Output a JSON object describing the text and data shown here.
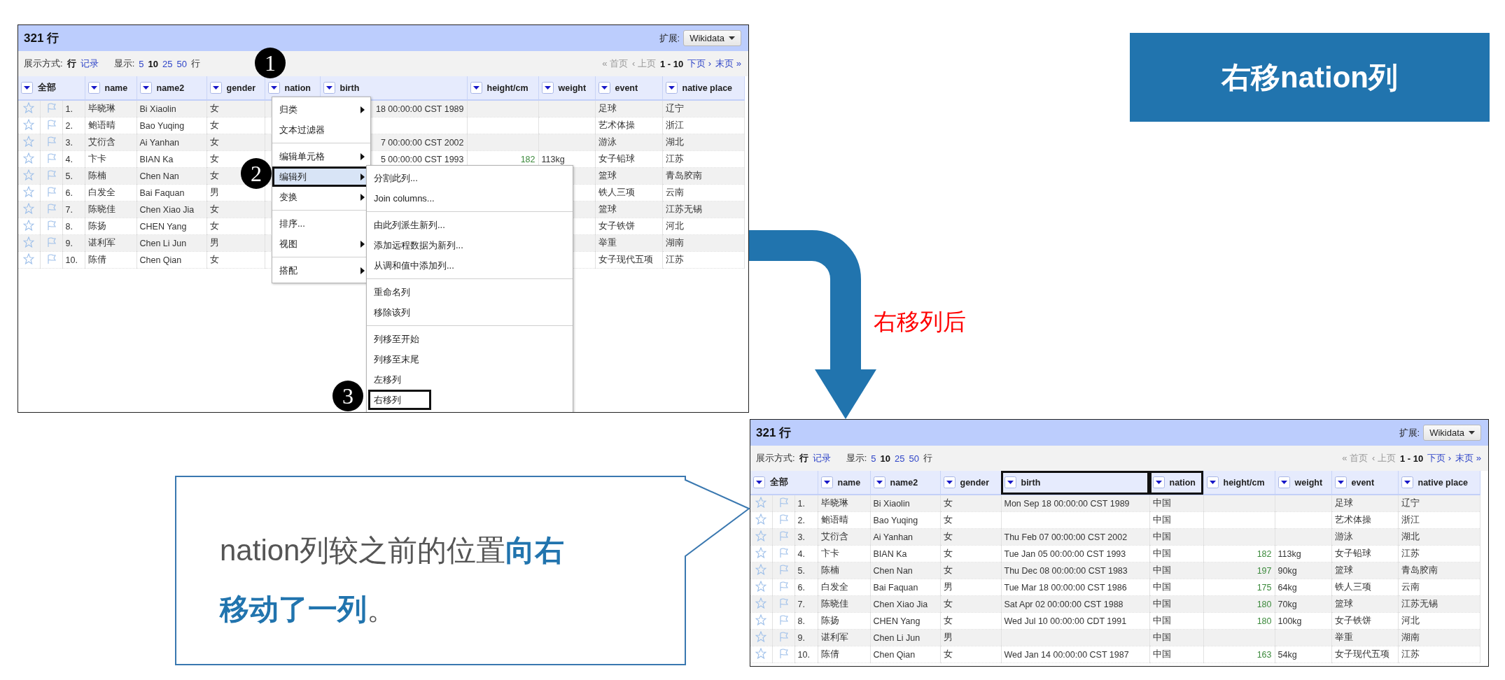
{
  "title": "右移nation列",
  "screenshots": [
    {
      "header": {
        "row_count": "321 行",
        "extension_label": "扩展:",
        "extension_button": "Wikidata"
      },
      "toolbar": {
        "view_label": "展示方式:",
        "view_modes": [
          {
            "label": "行",
            "selected": true
          },
          {
            "label": "记录",
            "selected": false
          }
        ],
        "show_label": "显示:",
        "page_sizes": [
          {
            "label": "5",
            "selected": false
          },
          {
            "label": "10",
            "selected": true
          },
          {
            "label": "25",
            "selected": false
          },
          {
            "label": "50",
            "selected": false
          }
        ],
        "show_unit": "行",
        "pager": [
          {
            "label": "« 首页",
            "kind": "disabled"
          },
          {
            "label": "‹ 上页",
            "kind": "disabled"
          },
          {
            "label": "1 - 10",
            "kind": "current"
          },
          {
            "label": "下页 ›",
            "kind": "link"
          },
          {
            "label": "末页 »",
            "kind": "link"
          }
        ]
      },
      "columns": [
        {
          "label": "全部",
          "kind": "all",
          "colspan": 3,
          "boxed": false
        },
        {
          "label": "name",
          "kind": "text",
          "boxed": false
        },
        {
          "label": "name2",
          "kind": "text",
          "boxed": false
        },
        {
          "label": "gender",
          "kind": "text",
          "boxed": false
        },
        {
          "label": "nation",
          "kind": "text",
          "boxed": false
        },
        {
          "label": "birth",
          "kind": "clipped",
          "boxed": false
        },
        {
          "label": "height/cm",
          "kind": "number",
          "boxed": false
        },
        {
          "label": "weight",
          "kind": "text",
          "boxed": false
        },
        {
          "label": "event",
          "kind": "text",
          "boxed": false
        },
        {
          "label": "native place",
          "kind": "text",
          "boxed": false
        }
      ],
      "rows": [
        {
          "cells": [
            "",
            "",
            "1.",
            "毕晓琳",
            "Bi Xiaolin",
            "女",
            "",
            "18 00:00:00 CST 1989",
            "",
            "",
            "足球",
            "辽宁"
          ]
        },
        {
          "cells": [
            "",
            "",
            "2.",
            "鲍语晴",
            "Bao Yuqing",
            "女",
            "",
            "",
            "",
            "",
            "艺术体操",
            "浙江"
          ]
        },
        {
          "cells": [
            "",
            "",
            "3.",
            "艾衍含",
            "Ai Yanhan",
            "女",
            "",
            "7 00:00:00 CST 2002",
            "",
            "",
            "游泳",
            "湖北"
          ]
        },
        {
          "cells": [
            "",
            "",
            "4.",
            "卞卡",
            "BIAN Ka",
            "女",
            "",
            "5 00:00:00 CST 1993",
            "182",
            "113kg",
            "女子铅球",
            "江苏"
          ]
        },
        {
          "cells": [
            "",
            "",
            "5.",
            "陈楠",
            "Chen Nan",
            "女",
            "",
            "",
            "",
            "",
            "篮球",
            "青岛胶南"
          ]
        },
        {
          "cells": [
            "",
            "",
            "6.",
            "白发全",
            "Bai Faquan",
            "男",
            "",
            "",
            "",
            "",
            "铁人三项",
            "云南"
          ]
        },
        {
          "cells": [
            "",
            "",
            "7.",
            "陈晓佳",
            "Chen Xiao Jia",
            "女",
            "",
            "",
            "",
            "",
            "篮球",
            "江苏无锡"
          ]
        },
        {
          "cells": [
            "",
            "",
            "8.",
            "陈扬",
            "CHEN Yang",
            "女",
            "",
            "",
            "",
            "",
            "女子铁饼",
            "河北"
          ]
        },
        {
          "cells": [
            "",
            "",
            "9.",
            "谌利军",
            "Chen Li Jun",
            "男",
            "",
            "",
            "",
            "",
            "举重",
            "湖南"
          ]
        },
        {
          "cells": [
            "",
            "",
            "10.",
            "陈倩",
            "Chen Qian",
            "女",
            "",
            "",
            "",
            "",
            "女子现代五项",
            "江苏"
          ]
        }
      ],
      "menu": [
        {
          "kind": "item",
          "label": "归类",
          "has_submenu": true,
          "highlighted": false,
          "boxed": false
        },
        {
          "kind": "item",
          "label": "文本过滤器",
          "has_submenu": false,
          "highlighted": false,
          "boxed": false
        },
        {
          "kind": "separator"
        },
        {
          "kind": "item",
          "label": "编辑单元格",
          "has_submenu": true,
          "highlighted": false,
          "boxed": false
        },
        {
          "kind": "item",
          "label": "编辑列",
          "has_submenu": true,
          "highlighted": true,
          "boxed": true
        },
        {
          "kind": "item",
          "label": "变换",
          "has_submenu": true,
          "highlighted": false,
          "boxed": false
        },
        {
          "kind": "separator"
        },
        {
          "kind": "item",
          "label": "排序...",
          "has_submenu": false,
          "highlighted": false,
          "boxed": false
        },
        {
          "kind": "item",
          "label": "视图",
          "has_submenu": true,
          "highlighted": false,
          "boxed": false
        },
        {
          "kind": "separator"
        },
        {
          "kind": "item",
          "label": "搭配",
          "has_submenu": true,
          "highlighted": false,
          "boxed": false
        }
      ],
      "submenu": [
        {
          "kind": "item",
          "label": "分割此列...",
          "has_submenu": false,
          "highlighted": false,
          "boxed": false
        },
        {
          "kind": "item",
          "label": "Join columns...",
          "has_submenu": false,
          "highlighted": false,
          "boxed": false
        },
        {
          "kind": "separator"
        },
        {
          "kind": "item",
          "label": "由此列派生新列...",
          "has_submenu": false,
          "highlighted": false,
          "boxed": false
        },
        {
          "kind": "item",
          "label": "添加远程数据为新列...",
          "has_submenu": false,
          "highlighted": false,
          "boxed": false
        },
        {
          "kind": "item",
          "label": "从调和值中添加列...",
          "has_submenu": false,
          "highlighted": false,
          "boxed": false
        },
        {
          "kind": "separator"
        },
        {
          "kind": "item",
          "label": "重命名列",
          "has_submenu": false,
          "highlighted": false,
          "boxed": false
        },
        {
          "kind": "item",
          "label": "移除该列",
          "has_submenu": false,
          "highlighted": false,
          "boxed": false
        },
        {
          "kind": "separator"
        },
        {
          "kind": "item",
          "label": "列移至开始",
          "has_submenu": false,
          "highlighted": false,
          "boxed": false
        },
        {
          "kind": "item",
          "label": "列移至末尾",
          "has_submenu": false,
          "highlighted": false,
          "boxed": false
        },
        {
          "kind": "item",
          "label": "左移列",
          "has_submenu": false,
          "highlighted": false,
          "boxed": false
        },
        {
          "kind": "item",
          "label": "右移列",
          "has_submenu": false,
          "highlighted": false,
          "boxed": true
        }
      ],
      "markers": [
        "1",
        "2",
        "3"
      ]
    },
    {
      "header": {
        "row_count": "321 行",
        "extension_label": "扩展:",
        "extension_button": "Wikidata"
      },
      "toolbar": {
        "view_label": "展示方式:",
        "view_modes": [
          {
            "label": "行",
            "selected": true
          },
          {
            "label": "记录",
            "selected": false
          }
        ],
        "show_label": "显示:",
        "page_sizes": [
          {
            "label": "5",
            "selected": false
          },
          {
            "label": "10",
            "selected": true
          },
          {
            "label": "25",
            "selected": false
          },
          {
            "label": "50",
            "selected": false
          }
        ],
        "show_unit": "行",
        "pager": [
          {
            "label": "« 首页",
            "kind": "disabled"
          },
          {
            "label": "‹ 上页",
            "kind": "disabled"
          },
          {
            "label": "1 - 10",
            "kind": "current"
          },
          {
            "label": "下页 ›",
            "kind": "link"
          },
          {
            "label": "末页 »",
            "kind": "link"
          }
        ]
      },
      "columns": [
        {
          "label": "全部",
          "kind": "all",
          "colspan": 3,
          "boxed": false
        },
        {
          "label": "name",
          "kind": "text",
          "boxed": false
        },
        {
          "label": "name2",
          "kind": "text",
          "boxed": false
        },
        {
          "label": "gender",
          "kind": "text",
          "boxed": false
        },
        {
          "label": "birth",
          "kind": "text",
          "boxed": true
        },
        {
          "label": "nation",
          "kind": "text",
          "boxed": true
        },
        {
          "label": "height/cm",
          "kind": "number",
          "boxed": false
        },
        {
          "label": "weight",
          "kind": "text",
          "boxed": false
        },
        {
          "label": "event",
          "kind": "text",
          "boxed": false
        },
        {
          "label": "native place",
          "kind": "text",
          "boxed": false
        }
      ],
      "rows": [
        {
          "cells": [
            "",
            "",
            "1.",
            "毕晓琳",
            "Bi Xiaolin",
            "女",
            "Mon Sep 18 00:00:00 CST 1989",
            "中国",
            "",
            "",
            "足球",
            "辽宁"
          ]
        },
        {
          "cells": [
            "",
            "",
            "2.",
            "鲍语晴",
            "Bao Yuqing",
            "女",
            "",
            "中国",
            "",
            "",
            "艺术体操",
            "浙江"
          ]
        },
        {
          "cells": [
            "",
            "",
            "3.",
            "艾衍含",
            "Ai Yanhan",
            "女",
            "Thu Feb 07 00:00:00 CST 2002",
            "中国",
            "",
            "",
            "游泳",
            "湖北"
          ]
        },
        {
          "cells": [
            "",
            "",
            "4.",
            "卞卡",
            "BIAN Ka",
            "女",
            "Tue Jan 05 00:00:00 CST 1993",
            "中国",
            "182",
            "113kg",
            "女子铅球",
            "江苏"
          ]
        },
        {
          "cells": [
            "",
            "",
            "5.",
            "陈楠",
            "Chen Nan",
            "女",
            "Thu Dec 08 00:00:00 CST 1983",
            "中国",
            "197",
            "90kg",
            "篮球",
            "青岛胶南"
          ]
        },
        {
          "cells": [
            "",
            "",
            "6.",
            "白发全",
            "Bai Faquan",
            "男",
            "Tue Mar 18 00:00:00 CST 1986",
            "中国",
            "175",
            "64kg",
            "铁人三项",
            "云南"
          ]
        },
        {
          "cells": [
            "",
            "",
            "7.",
            "陈晓佳",
            "Chen Xiao Jia",
            "女",
            "Sat Apr 02 00:00:00 CST 1988",
            "中国",
            "180",
            "70kg",
            "篮球",
            "江苏无锡"
          ]
        },
        {
          "cells": [
            "",
            "",
            "8.",
            "陈扬",
            "CHEN Yang",
            "女",
            "Wed Jul 10 00:00:00 CDT 1991",
            "中国",
            "180",
            "100kg",
            "女子铁饼",
            "河北"
          ]
        },
        {
          "cells": [
            "",
            "",
            "9.",
            "谌利军",
            "Chen Li Jun",
            "男",
            "",
            "中国",
            "",
            "",
            "举重",
            "湖南"
          ]
        },
        {
          "cells": [
            "",
            "",
            "10.",
            "陈倩",
            "Chen Qian",
            "女",
            "Wed Jan 14 00:00:00 CST 1987",
            "中国",
            "163",
            "54kg",
            "女子现代五项",
            "江苏"
          ]
        }
      ]
    }
  ],
  "arrow_label": "右移列后",
  "callout": {
    "text": "nation列较之前的位置**向右移动了一列**。"
  }
}
